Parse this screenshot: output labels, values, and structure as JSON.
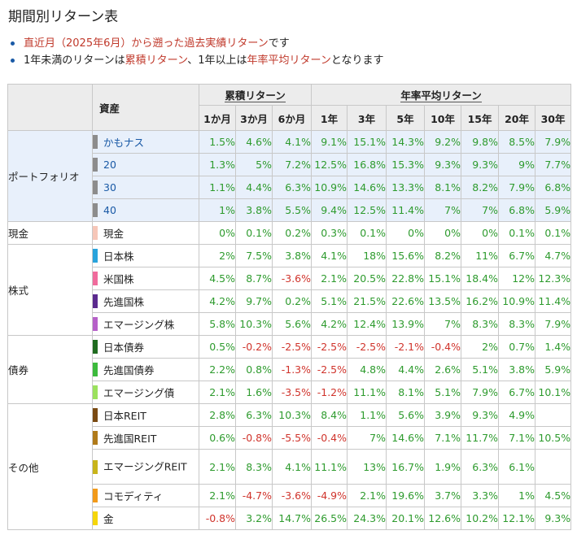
{
  "title": "期間別リターン表",
  "notes": [
    [
      {
        "t": "直近月（2025年6月）から遡った過去実績リターン",
        "red": true
      },
      {
        "t": "です",
        "red": false
      }
    ],
    [
      {
        "t": "1年未満のリターンは",
        "red": false
      },
      {
        "t": "累積リターン",
        "red": true
      },
      {
        "t": "、1年以上は",
        "red": false
      },
      {
        "t": "年率平均リターン",
        "red": true
      },
      {
        "t": "となります",
        "red": false
      }
    ]
  ],
  "table": {
    "asset_header": "資産",
    "group_cumulative": "累積リターン",
    "group_annual": "年率平均リターン",
    "periods": [
      "1か月",
      "3か月",
      "6か月",
      "1年",
      "3年",
      "5年",
      "10年",
      "15年",
      "20年",
      "30年"
    ],
    "groups": [
      {
        "category": "ポートフォリオ",
        "portfolio": true,
        "rows": [
          {
            "name": "かもナス",
            "color": "#8c8c8c",
            "values": [
              "1.5%",
              "4.6%",
              "4.1%",
              "9.1%",
              "15.1%",
              "14.3%",
              "9.2%",
              "9.8%",
              "8.5%",
              "7.9%"
            ]
          },
          {
            "name": "20",
            "color": "#8c8c8c",
            "values": [
              "1.3%",
              "5%",
              "7.2%",
              "12.5%",
              "16.8%",
              "15.3%",
              "9.3%",
              "9.3%",
              "9%",
              "7.7%"
            ]
          },
          {
            "name": "30",
            "color": "#8c8c8c",
            "values": [
              "1.1%",
              "4.4%",
              "6.3%",
              "10.9%",
              "14.6%",
              "13.3%",
              "8.1%",
              "8.2%",
              "7.9%",
              "6.8%"
            ]
          },
          {
            "name": "40",
            "color": "#8c8c8c",
            "values": [
              "1%",
              "3.8%",
              "5.5%",
              "9.4%",
              "12.5%",
              "11.4%",
              "7%",
              "7%",
              "6.8%",
              "5.9%"
            ]
          }
        ]
      },
      {
        "category": "現金",
        "portfolio": false,
        "rows": [
          {
            "name": "現金",
            "color": "#f6c6b8",
            "values": [
              "0%",
              "0.1%",
              "0.2%",
              "0.3%",
              "0.1%",
              "0%",
              "0%",
              "0%",
              "0.1%",
              "0.1%"
            ]
          }
        ]
      },
      {
        "category": "株式",
        "portfolio": false,
        "rows": [
          {
            "name": "日本株",
            "color": "#29a3dc",
            "values": [
              "2%",
              "7.5%",
              "3.8%",
              "4.1%",
              "18%",
              "15.6%",
              "8.2%",
              "11%",
              "6.7%",
              "4.7%"
            ]
          },
          {
            "name": "米国株",
            "color": "#f06b9c",
            "values": [
              "4.5%",
              "8.7%",
              "-3.6%",
              "2.1%",
              "20.5%",
              "22.8%",
              "15.1%",
              "18.4%",
              "12%",
              "12.3%"
            ]
          },
          {
            "name": "先進国株",
            "color": "#5b2a8e",
            "values": [
              "4.2%",
              "9.7%",
              "0.2%",
              "5.1%",
              "21.5%",
              "22.6%",
              "13.5%",
              "16.2%",
              "10.9%",
              "11.4%"
            ]
          },
          {
            "name": "エマージング株",
            "color": "#b660c8",
            "values": [
              "5.8%",
              "10.3%",
              "5.6%",
              "4.2%",
              "12.4%",
              "13.9%",
              "7%",
              "8.3%",
              "8.3%",
              "7.9%"
            ]
          }
        ]
      },
      {
        "category": "債券",
        "portfolio": false,
        "rows": [
          {
            "name": "日本債券",
            "color": "#1f6b1f",
            "values": [
              "0.5%",
              "-0.2%",
              "-2.5%",
              "-2.5%",
              "-2.5%",
              "-2.1%",
              "-0.4%",
              "2%",
              "0.7%",
              "1.4%"
            ]
          },
          {
            "name": "先進国債券",
            "color": "#3cba3c",
            "values": [
              "2.2%",
              "0.8%",
              "-1.3%",
              "-2.5%",
              "4.8%",
              "4.4%",
              "2.6%",
              "5.1%",
              "3.8%",
              "5.9%"
            ]
          },
          {
            "name": "エマージング債",
            "color": "#9be15d",
            "values": [
              "2.1%",
              "1.6%",
              "-3.5%",
              "-1.2%",
              "11.1%",
              "8.1%",
              "5.1%",
              "7.9%",
              "6.7%",
              "10.1%"
            ]
          }
        ]
      },
      {
        "category": "その他",
        "portfolio": false,
        "rows": [
          {
            "name": "日本REIT",
            "color": "#7a4a12",
            "values": [
              "2.8%",
              "6.3%",
              "10.3%",
              "8.4%",
              "1.1%",
              "5.6%",
              "3.9%",
              "9.3%",
              "4.9%",
              ""
            ]
          },
          {
            "name": "先進国REIT",
            "color": "#b07a1a",
            "values": [
              "0.6%",
              "-0.8%",
              "-5.5%",
              "-0.4%",
              "7%",
              "14.6%",
              "7.1%",
              "11.7%",
              "7.1%",
              "10.5%"
            ]
          },
          {
            "name": "エマージングREIT",
            "color": "#c8b41a",
            "values": [
              "2.1%",
              "8.3%",
              "4.1%",
              "11.1%",
              "13%",
              "16.7%",
              "1.9%",
              "6.3%",
              "6.1%",
              ""
            ],
            "tall": true
          },
          {
            "name": "コモディティ",
            "color": "#f29a1a",
            "values": [
              "2.1%",
              "-4.7%",
              "-3.6%",
              "-4.9%",
              "2.1%",
              "19.6%",
              "3.7%",
              "3.3%",
              "1%",
              "4.5%"
            ]
          },
          {
            "name": "金",
            "color": "#f5d60a",
            "values": [
              "-0.8%",
              "3.2%",
              "14.7%",
              "26.5%",
              "24.3%",
              "20.1%",
              "12.6%",
              "10.2%",
              "12.1%",
              "9.3%"
            ]
          }
        ]
      }
    ]
  }
}
